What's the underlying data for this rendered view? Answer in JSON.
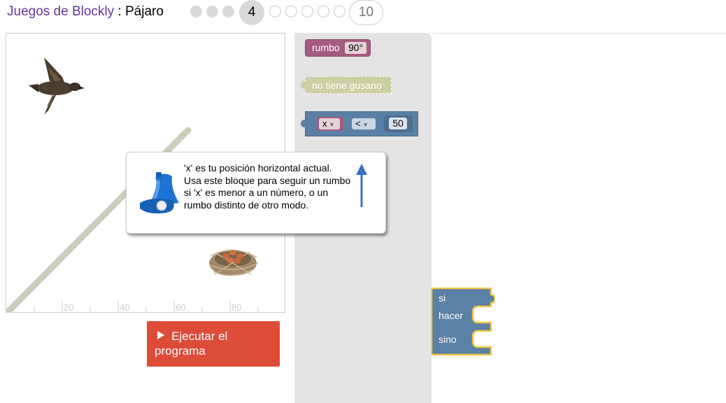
{
  "header": {
    "app_title": "Juegos de Blockly",
    "separator": " : ",
    "game_title": "Pájaro",
    "current_level": "4",
    "last_level": "10"
  },
  "canvas": {
    "axis_ticks": [
      "20",
      "40",
      "60",
      "80"
    ]
  },
  "run_button": {
    "label": "Ejecutar el programa",
    "icon": "play-icon"
  },
  "toolbox": {
    "heading_block": {
      "label": "rumbo",
      "value": "90°"
    },
    "worm_block": {
      "label": "no tiene gusano"
    },
    "compare_block": {
      "variable": "x",
      "operator": "<",
      "number": "50"
    }
  },
  "workspace": {
    "if_block": {
      "if_label": "si",
      "do_label": "hacer",
      "else_label": "sino"
    }
  },
  "tooltip": {
    "text": "'x' es tu posición horizontal actual. Usa este bloque para seguir un rumbo si 'x' es menor a un número, o un rumbo distinto de otro modo.",
    "icons": [
      "bell-icon",
      "arrow-up-icon"
    ]
  },
  "colors": {
    "title_link": "#60379a",
    "run_button": "#dd4b39",
    "heading_block": "#a55b80",
    "worm_block": "#cccea4",
    "logic_block": "#5b80a5",
    "selected_outline": "#f3c744",
    "flyout_bg": "#e4e4e4"
  }
}
